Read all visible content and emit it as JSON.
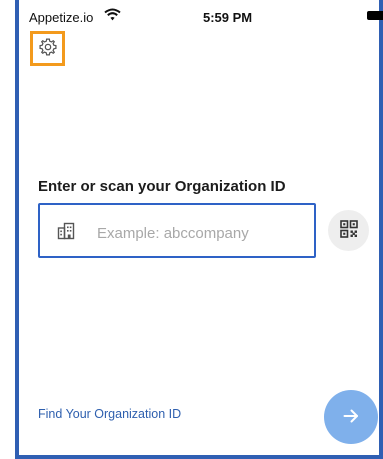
{
  "status_bar": {
    "carrier": "Appetize.io",
    "time": "5:59 PM",
    "wifi_icon": "wifi-icon",
    "battery_icon": "battery-icon"
  },
  "toolbar": {
    "settings_icon": "gear-icon"
  },
  "main": {
    "prompt": "Enter or scan your Organization ID",
    "org_input": {
      "placeholder": "Example: abccompany",
      "value": "",
      "icon": "building-icon"
    },
    "qr_button_icon": "qr-code-icon"
  },
  "footer": {
    "find_link": "Find Your Organization ID",
    "next_icon": "arrow-right-icon"
  },
  "colors": {
    "frame": "#2f5fb3",
    "input_border": "#2e62c6",
    "link": "#2e5fae",
    "next_button": "#7fb0eb",
    "highlight": "#f39a1c"
  }
}
